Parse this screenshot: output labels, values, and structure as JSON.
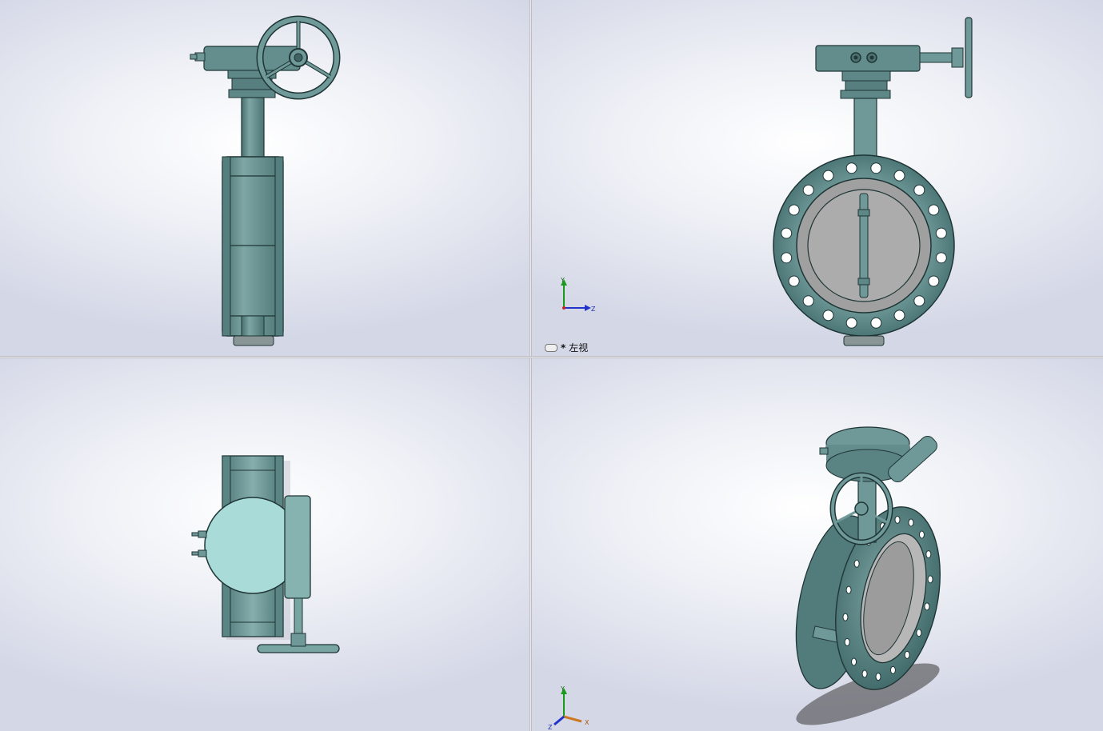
{
  "viewports": {
    "top_left": {
      "name": "front-view"
    },
    "top_right": {
      "name": "left-view",
      "label_prefix": "*",
      "label": "左视"
    },
    "bottom_left": {
      "name": "top-view"
    },
    "bottom_right": {
      "name": "isometric-view"
    }
  },
  "triad": {
    "y": "Y",
    "z": "Z",
    "x": "X"
  },
  "colors": {
    "body": "#5f8a8a",
    "body_light": "#7fa7a5",
    "disc_grey": "#a8a8a8",
    "background_center": "#ffffff",
    "background_edge": "#d4d7e6"
  }
}
